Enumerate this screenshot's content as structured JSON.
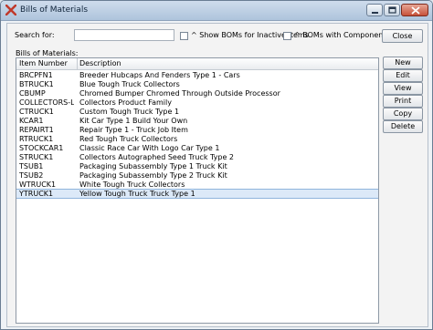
{
  "window": {
    "title": "Bills of Materials"
  },
  "search": {
    "label": "Search for:",
    "value": "",
    "placeholder": ""
  },
  "options": {
    "inactive_label": "^ Show BOMs for Inactive Items",
    "component_label": "^  BOMs with Component Items"
  },
  "buttons": {
    "close": "Close",
    "new": "New",
    "edit": "Edit",
    "view": "View",
    "print": "Print",
    "copy": "Copy",
    "delete": "Delete"
  },
  "list": {
    "caption": "Bills of Materials:",
    "columns": [
      "Item Number",
      "Description"
    ],
    "selected_index": 13,
    "rows": [
      {
        "item": "BRCPFN1",
        "description": "Breeder Hubcaps And Fenders Type 1 - Cars"
      },
      {
        "item": "BTRUCK1",
        "description": "Blue Tough Truck Collectors"
      },
      {
        "item": "CBUMP",
        "description": "Chromed Bumper Chromed Through Outside Processor"
      },
      {
        "item": "COLLECTORS-L...",
        "description": "Collectors Product Family"
      },
      {
        "item": "CTRUCK1",
        "description": "Custom Tough Truck Type 1"
      },
      {
        "item": "KCAR1",
        "description": "Kit Car Type 1 Build Your Own"
      },
      {
        "item": "REPAIRT1",
        "description": "Repair Type 1 - Truck  Job Item"
      },
      {
        "item": "RTRUCK1",
        "description": "Red Tough Truck Collectors"
      },
      {
        "item": "STOCKCAR1",
        "description": "Classic Race Car With Logo Car Type 1"
      },
      {
        "item": "STRUCK1",
        "description": "Collectors Autographed Seed Truck Type 2"
      },
      {
        "item": "TSUB1",
        "description": "Packaging Subassembly Type 1 Truck Kit"
      },
      {
        "item": "TSUB2",
        "description": "Packaging Subassembly Type 2 Truck Kit"
      },
      {
        "item": "WTRUCK1",
        "description": "White Tough Truck Collectors"
      },
      {
        "item": "YTRUCK1",
        "description": "Yellow Tough Truck Truck Type 1"
      }
    ]
  }
}
